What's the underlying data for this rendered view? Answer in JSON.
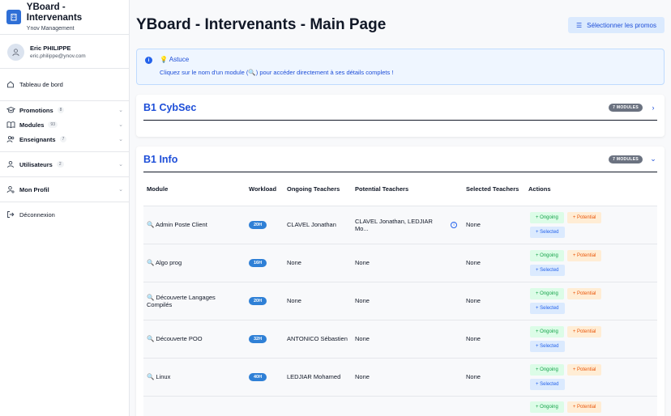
{
  "brand": {
    "title": "YBoard - Intervenants",
    "subtitle": "Ynov Management"
  },
  "user": {
    "name": "Eric PHILIPPE",
    "email": "eric.philippe@ynov.com"
  },
  "sidebar": {
    "dashboard": "Tableau de bord",
    "promotions": {
      "label": "Promotions",
      "count": "8"
    },
    "modules": {
      "label": "Modules",
      "count": "93"
    },
    "teachers": {
      "label": "Enseignants",
      "count": "7"
    },
    "users": {
      "label": "Utilisateurs",
      "count": "2"
    },
    "profile": "Mon Profil",
    "logout": "Déconnexion"
  },
  "header": {
    "title": "YBoard - Intervenants - Main Page",
    "promo_button": "Sélectionner les promos"
  },
  "tip": {
    "title": "💡 Astuce",
    "text": "Cliquez sur le nom d'un module (🔍) pour accéder directement à ses détails complets !"
  },
  "promotions": [
    {
      "name": "B1 CybSec",
      "badge": "7 MODULES"
    },
    {
      "name": "B1 Info",
      "badge": "7 MODULES"
    }
  ],
  "table": {
    "headers": [
      "Module",
      "Workload",
      "Ongoing Teachers",
      "Potential Teachers",
      "Selected Teachers",
      "Actions"
    ],
    "actions": {
      "ongoing": "+ Ongoing",
      "potential": "+ Potential",
      "selected": "+ Selected"
    },
    "rows": [
      {
        "module": "🔍 Admin Poste Client",
        "workload": "20H",
        "ongoing": "CLAVEL Jonathan",
        "potential": "CLAVEL Jonathan, LEDJIAR Mo...",
        "selected": "None"
      },
      {
        "module": "🔍 Algo prog",
        "workload": "16H",
        "ongoing": "None",
        "potential": "None",
        "selected": "None"
      },
      {
        "module": "🔍 Découverte Langages Compilés",
        "workload": "20H",
        "ongoing": "None",
        "potential": "None",
        "selected": "None"
      },
      {
        "module": "🔍 Découverte POO",
        "workload": "32H",
        "ongoing": "ANTONICO Sébastien",
        "potential": "None",
        "selected": "None"
      },
      {
        "module": "🔍 Linux",
        "workload": "40H",
        "ongoing": "LEDJIAR Mohamed",
        "potential": "None",
        "selected": "None"
      }
    ]
  },
  "colors": {
    "accent": "#1d4ed8",
    "workload_badge": "#2f80d6"
  }
}
